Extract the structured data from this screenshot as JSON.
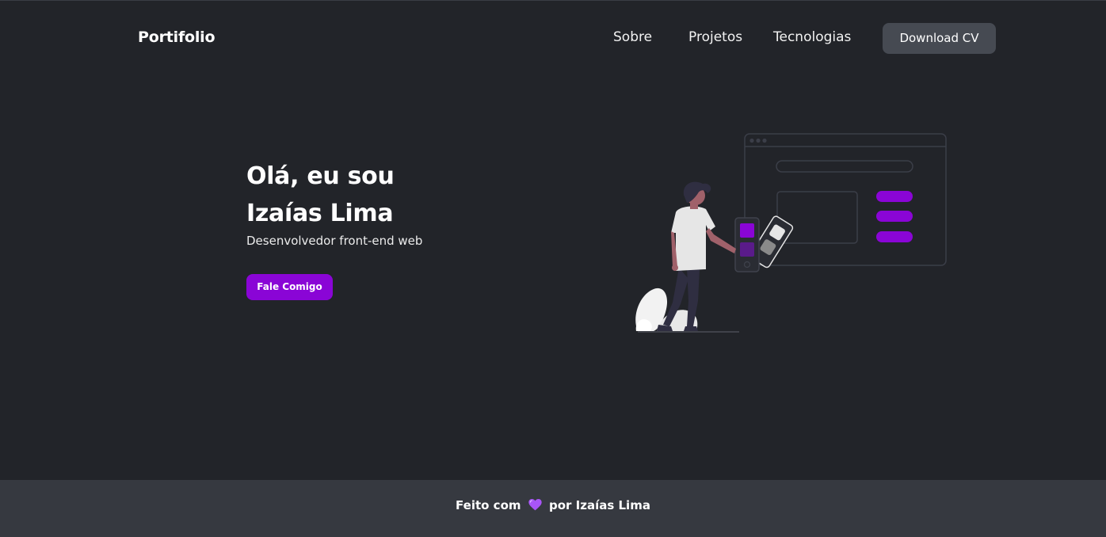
{
  "header": {
    "brand": "Portifolio",
    "nav": [
      "Sobre",
      "Projetos",
      "Tecnologias"
    ],
    "download_button": "Download CV"
  },
  "hero": {
    "title_line1": "Olá, eu sou",
    "title_line2": "Izaías Lima",
    "subtitle": "Desenvolvedor front-end web",
    "cta_button": "Fale Comigo"
  },
  "footer": {
    "text_before": "Feito com",
    "icon": "purple-heart-icon",
    "text_after": "por Izaías Lima"
  },
  "colors": {
    "background": "#222429",
    "footer_background": "#363940",
    "accent": "#8a05d6",
    "button_secondary": "#464a52",
    "text": "#ffffff"
  }
}
